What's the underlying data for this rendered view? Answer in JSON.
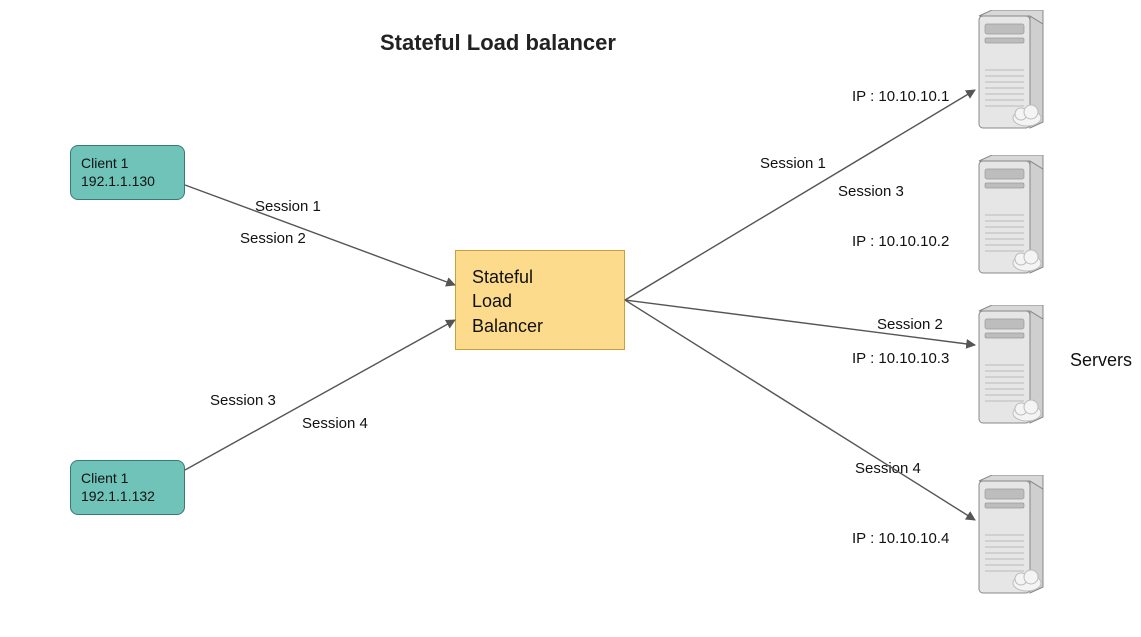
{
  "title": "Stateful Load balancer",
  "clients": [
    {
      "name": "Client 1",
      "ip": "192.1.1.130"
    },
    {
      "name": "Client 1",
      "ip": "192.1.1.132"
    }
  ],
  "load_balancer": {
    "line1": "Stateful",
    "line2": "Load",
    "line3": "Balancer"
  },
  "sessions_left": {
    "s1": "Session 1",
    "s2": "Session 2",
    "s3": "Session 3",
    "s4": "Session 4"
  },
  "sessions_right": {
    "s1": "Session 1",
    "s2": "Session 2",
    "s3": "Session 3",
    "s4": "Session 4"
  },
  "servers": [
    {
      "ip_label": "IP : 10.10.10.1"
    },
    {
      "ip_label": "IP : 10.10.10.2"
    },
    {
      "ip_label": "IP : 10.10.10.3"
    },
    {
      "ip_label": "IP : 10.10.10.4"
    }
  ],
  "servers_heading": "Servers"
}
